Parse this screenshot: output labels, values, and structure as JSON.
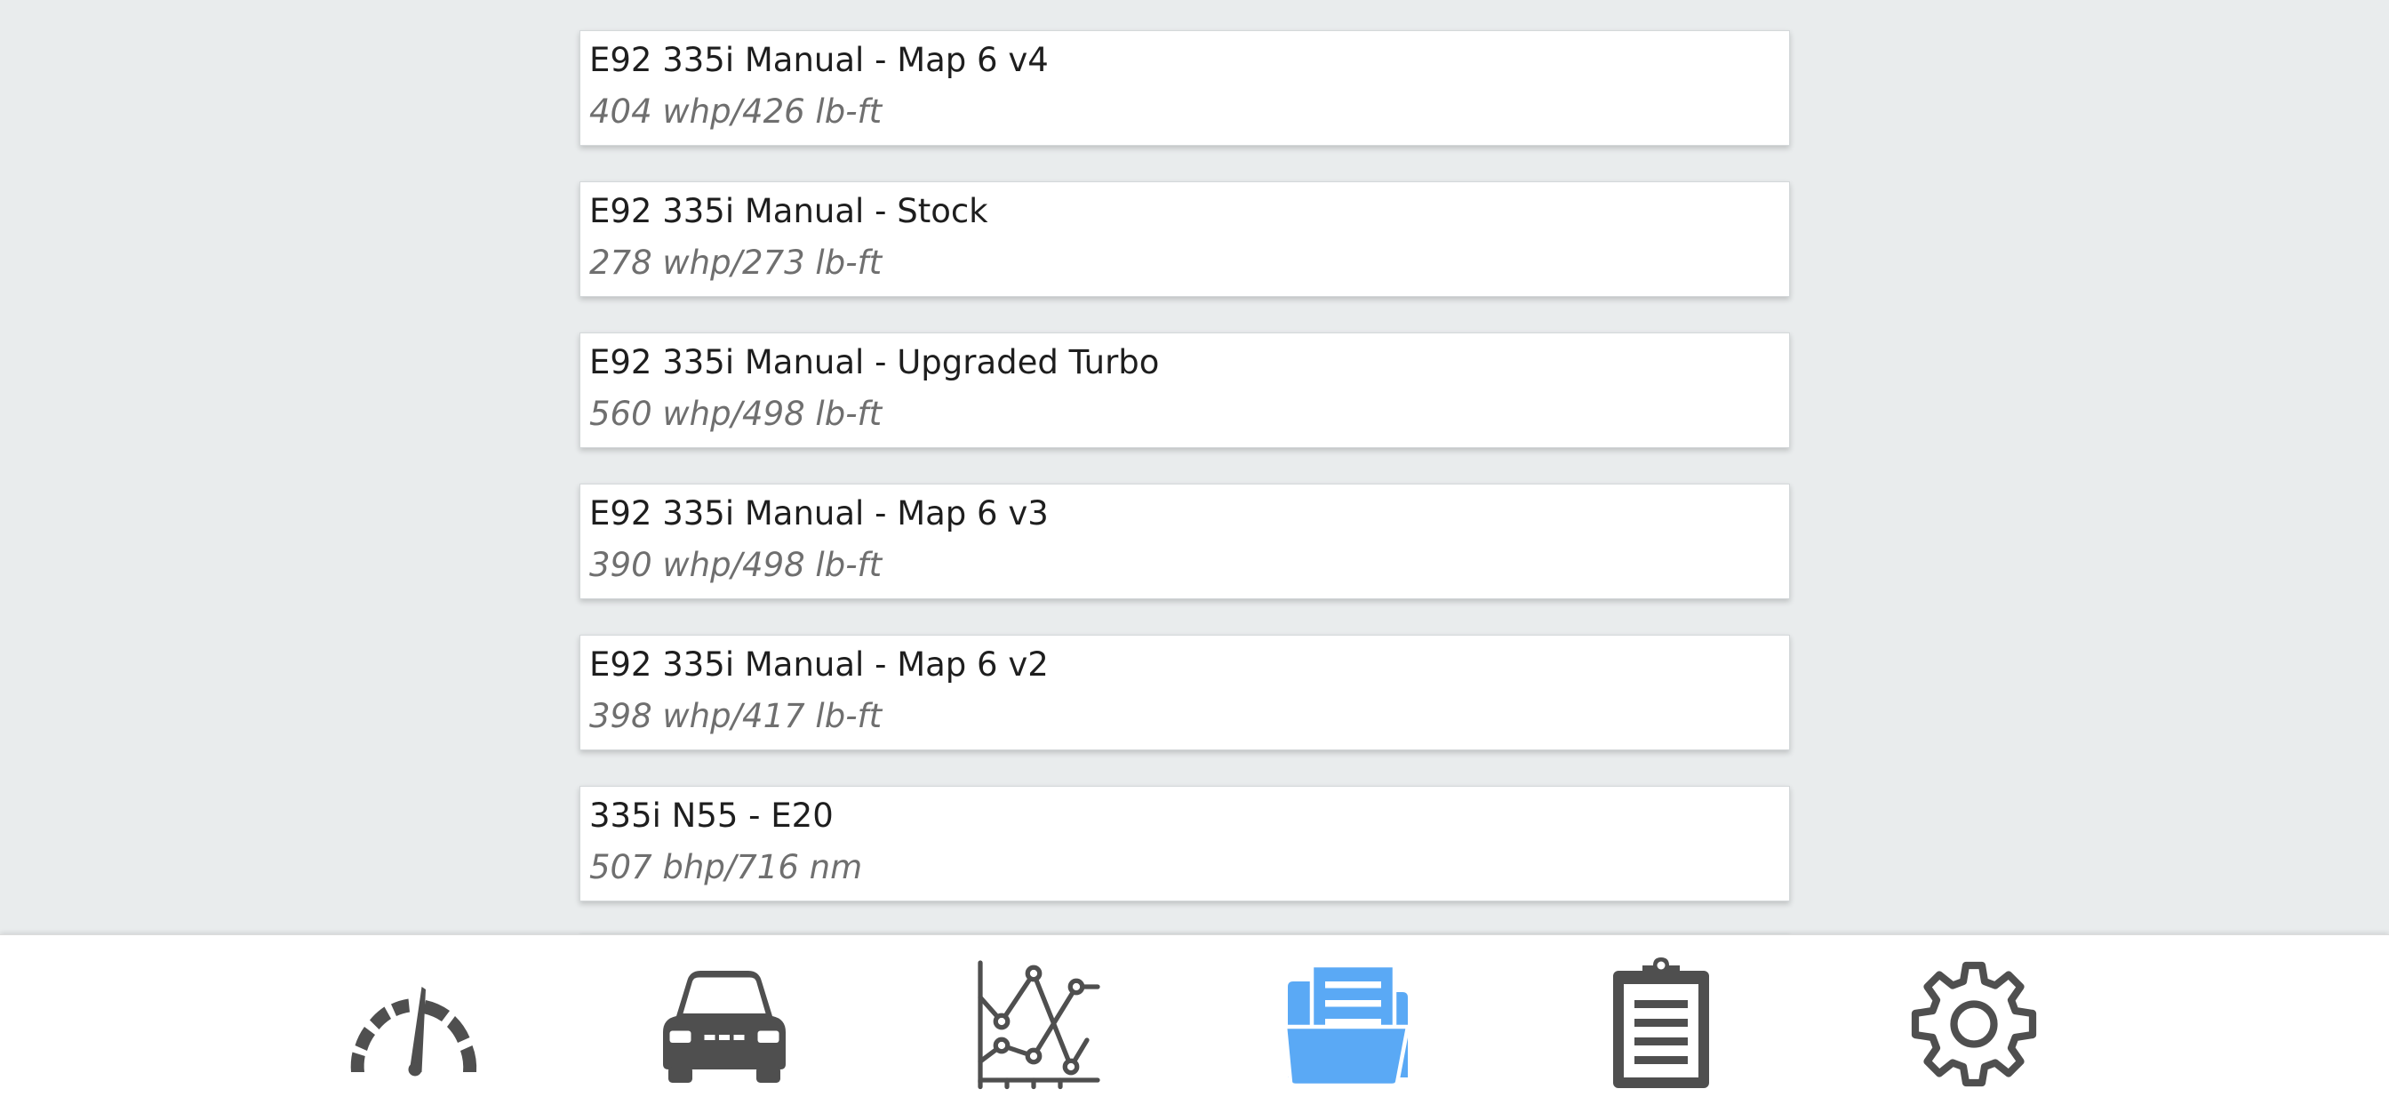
{
  "maps": [
    {
      "name": "E92 335i Manual - Map 6 v4",
      "stats": "404 whp/426 lb-ft"
    },
    {
      "name": "E92 335i Manual - Stock",
      "stats": "278 whp/273 lb-ft"
    },
    {
      "name": "E92 335i Manual - Upgraded Turbo",
      "stats": "560 whp/498 lb-ft"
    },
    {
      "name": "E92 335i Manual - Map 6 v3",
      "stats": "390 whp/498 lb-ft"
    },
    {
      "name": "E92 335i Manual - Map 6 v2",
      "stats": "398 whp/417 lb-ft"
    },
    {
      "name": "335i N55 - E20",
      "stats": "507 bhp/716 nm"
    }
  ],
  "navbar": {
    "items": [
      {
        "icon": "gauge-icon",
        "active": false
      },
      {
        "icon": "car-icon",
        "active": false
      },
      {
        "icon": "chart-icon",
        "active": false
      },
      {
        "icon": "folder-icon",
        "active": true
      },
      {
        "icon": "clipboard-icon",
        "active": false
      },
      {
        "icon": "gear-icon",
        "active": false
      }
    ],
    "colors": {
      "active": "#5aa9f5",
      "inactive": "#4f4f4f"
    }
  }
}
